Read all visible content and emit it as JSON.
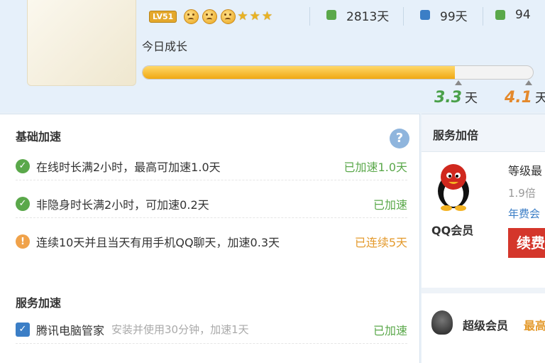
{
  "header": {
    "level_badge": "LV51",
    "stats": [
      {
        "value": "2813天",
        "icon": "calendar-icon",
        "color": "#5aa84a"
      },
      {
        "value": "99天",
        "icon": "tv-icon",
        "color": "#3b7ec6"
      },
      {
        "value": "94",
        "icon": "rank-icon",
        "color": "#5aa84a"
      }
    ],
    "growth_label": "今日成长",
    "progress_percent": 80,
    "markers": [
      {
        "num": "3.3",
        "unit": "天",
        "color": "#4aa04a"
      },
      {
        "num": "4.1",
        "unit": "天",
        "color": "#e4892c"
      }
    ]
  },
  "basic": {
    "title": "基础加速",
    "help": "?",
    "rows": [
      {
        "text": "在线时长满2小时，最高可加速1.0天",
        "status": "已加速1.0天",
        "icon": "check-icon",
        "status_color": "green"
      },
      {
        "text": "非隐身时长满2小时，可加速0.2天",
        "status": "已加速",
        "icon": "check-icon",
        "status_color": "green"
      },
      {
        "text": "连续10天并且当天有用手机QQ聊天，加速0.3天",
        "status": "已连续5天",
        "icon": "info-icon",
        "status_color": "orange"
      }
    ]
  },
  "service": {
    "title": "服务加速",
    "rows": [
      {
        "text": "腾讯电脑管家",
        "sub": "安装并使用30分钟，加速1天",
        "status": "已加速"
      }
    ]
  },
  "side": {
    "title": "服务加倍",
    "qq_label": "QQ会员",
    "line1": "等级最",
    "line2": "1.9倍",
    "line3": "年费会",
    "renew": "续费",
    "super_label": "超级会员",
    "super_tag": "最高"
  }
}
